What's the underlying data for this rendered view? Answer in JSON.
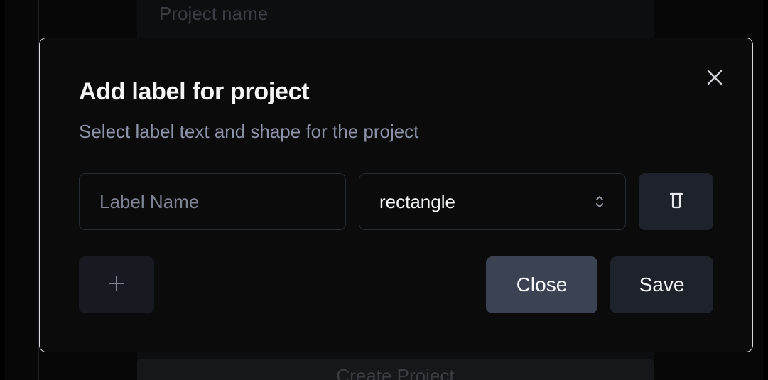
{
  "background": {
    "project_name_placeholder": "Project name",
    "create_button_label": "Create Project"
  },
  "modal": {
    "title": "Add label for project",
    "subtitle": "Select label text and shape for the project",
    "close_icon": "x-icon",
    "label_row": {
      "name_placeholder": "Label Name",
      "name_value": "",
      "shape_selected": "rectangle",
      "shape_icon": "chevron-up-down-icon",
      "delete_icon": "trash-icon"
    },
    "add_icon": "plus-icon",
    "close_button_label": "Close",
    "save_button_label": "Save"
  },
  "colors": {
    "modal_border": "#d9dadd",
    "modal_bg": "#0b0b0c",
    "subtitle": "#8c93a8",
    "close_button_bg": "#3b4252",
    "save_button_bg": "#1d222b"
  }
}
